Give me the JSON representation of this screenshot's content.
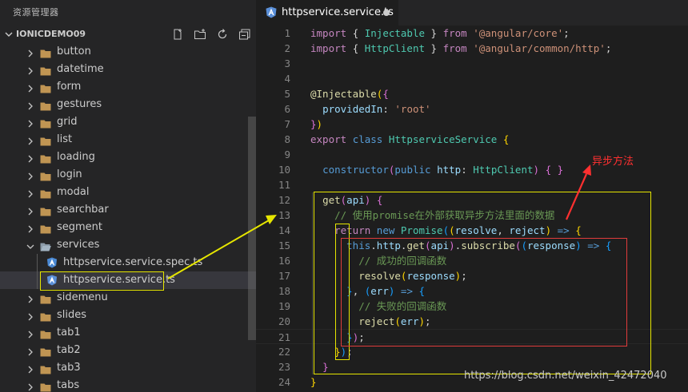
{
  "sidebar": {
    "title": "资源管理器",
    "section": "IONICDEMO09",
    "actions": [
      "new-file-icon",
      "new-folder-icon",
      "refresh-icon",
      "collapse-all-icon"
    ],
    "items": [
      {
        "label": "button",
        "kind": "folder"
      },
      {
        "label": "datetime",
        "kind": "folder"
      },
      {
        "label": "form",
        "kind": "folder"
      },
      {
        "label": "gestures",
        "kind": "folder"
      },
      {
        "label": "grid",
        "kind": "folder"
      },
      {
        "label": "list",
        "kind": "folder"
      },
      {
        "label": "loading",
        "kind": "folder"
      },
      {
        "label": "login",
        "kind": "folder"
      },
      {
        "label": "modal",
        "kind": "folder"
      },
      {
        "label": "searchbar",
        "kind": "folder"
      },
      {
        "label": "segment",
        "kind": "folder"
      },
      {
        "label": "services",
        "kind": "folder-open"
      },
      {
        "label": "httpservice.service.spec.ts",
        "kind": "spec-file"
      },
      {
        "label": "httpservice.service.ts",
        "kind": "angular-file"
      },
      {
        "label": "sidemenu",
        "kind": "folder"
      },
      {
        "label": "slides",
        "kind": "folder"
      },
      {
        "label": "tab1",
        "kind": "folder"
      },
      {
        "label": "tab2",
        "kind": "folder"
      },
      {
        "label": "tab3",
        "kind": "folder"
      },
      {
        "label": "tabs",
        "kind": "folder"
      }
    ]
  },
  "editor": {
    "tab_label": "httpservice.service.ts",
    "tab_dirty": true,
    "lines": [
      {
        "n": "1",
        "tokens": [
          [
            "k",
            "import "
          ],
          [
            "p",
            "{ "
          ],
          [
            "t",
            "Injectable"
          ],
          [
            "p",
            " } "
          ],
          [
            "k",
            "from "
          ],
          [
            "s",
            "'@angular/core'"
          ],
          [
            "p",
            ";"
          ]
        ]
      },
      {
        "n": "2",
        "tokens": [
          [
            "k",
            "import "
          ],
          [
            "p",
            "{ "
          ],
          [
            "t",
            "HttpClient"
          ],
          [
            "p",
            " } "
          ],
          [
            "k",
            "from "
          ],
          [
            "s",
            "'@angular/common/http'"
          ],
          [
            "p",
            ";"
          ]
        ]
      },
      {
        "n": "3",
        "tokens": []
      },
      {
        "n": "4",
        "tokens": []
      },
      {
        "n": "5",
        "tokens": [
          [
            "f",
            "@Injectable"
          ],
          [
            "b1",
            "("
          ],
          [
            "b2",
            "{"
          ]
        ]
      },
      {
        "n": "6",
        "tokens": [
          [
            "p",
            "  "
          ],
          [
            "v",
            "providedIn"
          ],
          [
            "p",
            ": "
          ],
          [
            "s",
            "'root'"
          ]
        ]
      },
      {
        "n": "7",
        "tokens": [
          [
            "b2",
            "}"
          ],
          [
            "b1",
            ")"
          ]
        ]
      },
      {
        "n": "8",
        "tokens": [
          [
            "k",
            "export "
          ],
          [
            "kb",
            "class "
          ],
          [
            "t",
            "HttpserviceService "
          ],
          [
            "b1",
            "{"
          ]
        ]
      },
      {
        "n": "9",
        "tokens": []
      },
      {
        "n": "10",
        "tokens": [
          [
            "p",
            "  "
          ],
          [
            "kb",
            "constructor"
          ],
          [
            "b2",
            "("
          ],
          [
            "kb",
            "public "
          ],
          [
            "v",
            "http"
          ],
          [
            "p",
            ": "
          ],
          [
            "t",
            "HttpClient"
          ],
          [
            "b2",
            ")"
          ],
          [
            "p",
            " "
          ],
          [
            "b2",
            "{"
          ],
          [
            "p",
            " "
          ],
          [
            "b2",
            "}"
          ]
        ]
      },
      {
        "n": "11",
        "tokens": []
      },
      {
        "n": "12",
        "tokens": [
          [
            "p",
            "  "
          ],
          [
            "f",
            "get"
          ],
          [
            "b2",
            "("
          ],
          [
            "v",
            "api"
          ],
          [
            "b2",
            ")"
          ],
          [
            "p",
            " "
          ],
          [
            "b2",
            "{"
          ]
        ]
      },
      {
        "n": "13",
        "tokens": [
          [
            "p",
            "    "
          ],
          [
            "c",
            "// 使用promise在外部获取异步方法里面的数据"
          ]
        ]
      },
      {
        "n": "14",
        "tokens": [
          [
            "p",
            "    "
          ],
          [
            "k",
            "return "
          ],
          [
            "kb",
            "new "
          ],
          [
            "t",
            "Promise"
          ],
          [
            "b3",
            "("
          ],
          [
            "b1",
            "("
          ],
          [
            "v",
            "resolve"
          ],
          [
            "p",
            ", "
          ],
          [
            "v",
            "reject"
          ],
          [
            "b1",
            ")"
          ],
          [
            "p",
            " "
          ],
          [
            "kb",
            "=>"
          ],
          [
            "p",
            " "
          ],
          [
            "b1",
            "{"
          ]
        ]
      },
      {
        "n": "15",
        "tokens": [
          [
            "p",
            "      "
          ],
          [
            "kb",
            "this"
          ],
          [
            "p",
            "."
          ],
          [
            "v",
            "http"
          ],
          [
            "p",
            "."
          ],
          [
            "f",
            "get"
          ],
          [
            "b2",
            "("
          ],
          [
            "v",
            "api"
          ],
          [
            "b2",
            ")"
          ],
          [
            "p",
            "."
          ],
          [
            "f",
            "subscribe"
          ],
          [
            "b2",
            "("
          ],
          [
            "b3",
            "("
          ],
          [
            "v",
            "response"
          ],
          [
            "b3",
            ")"
          ],
          [
            "p",
            " "
          ],
          [
            "kb",
            "=>"
          ],
          [
            "p",
            " "
          ],
          [
            "b3",
            "{"
          ]
        ]
      },
      {
        "n": "16",
        "tokens": [
          [
            "p",
            "        "
          ],
          [
            "c",
            "// 成功的回调函数"
          ]
        ]
      },
      {
        "n": "17",
        "tokens": [
          [
            "p",
            "        "
          ],
          [
            "f",
            "resolve"
          ],
          [
            "b1",
            "("
          ],
          [
            "v",
            "response"
          ],
          [
            "b1",
            ")"
          ],
          [
            "p",
            ";"
          ]
        ]
      },
      {
        "n": "18",
        "tokens": [
          [
            "p",
            "      "
          ],
          [
            "b3",
            "}"
          ],
          [
            "p",
            ", "
          ],
          [
            "b3",
            "("
          ],
          [
            "v",
            "err"
          ],
          [
            "b3",
            ")"
          ],
          [
            "p",
            " "
          ],
          [
            "kb",
            "=>"
          ],
          [
            "p",
            " "
          ],
          [
            "b3",
            "{"
          ]
        ]
      },
      {
        "n": "19",
        "tokens": [
          [
            "p",
            "        "
          ],
          [
            "c",
            "// 失败的回调函数"
          ]
        ]
      },
      {
        "n": "20",
        "tokens": [
          [
            "p",
            "        "
          ],
          [
            "f",
            "reject"
          ],
          [
            "b1",
            "("
          ],
          [
            "v",
            "err"
          ],
          [
            "b1",
            ")"
          ],
          [
            "p",
            ";"
          ]
        ]
      },
      {
        "n": "21",
        "tokens": [
          [
            "p",
            "      "
          ],
          [
            "b3",
            "}"
          ],
          [
            "b2",
            ")"
          ],
          [
            "p",
            ";"
          ]
        ]
      },
      {
        "n": "22",
        "tokens": [
          [
            "p",
            "    "
          ],
          [
            "b1",
            "}"
          ],
          [
            "b3",
            ")"
          ],
          [
            "p",
            ";"
          ]
        ]
      },
      {
        "n": "23",
        "tokens": [
          [
            "p",
            "  "
          ],
          [
            "b2",
            "}"
          ]
        ]
      },
      {
        "n": "24",
        "tokens": [
          [
            "b1",
            "}"
          ]
        ]
      }
    ]
  },
  "annotation": {
    "text": "异步方法",
    "color": "#ff3030"
  },
  "watermark": "https://blog.csdn.net/weixin_42472040",
  "colors": {
    "keyword": "#c586c0",
    "type": "#4ec9b0",
    "string": "#ce9178",
    "comment": "#6a9955",
    "highlight_yellow": "#e6e600",
    "highlight_red": "#e03c3c",
    "angular": "#dd1b16"
  }
}
